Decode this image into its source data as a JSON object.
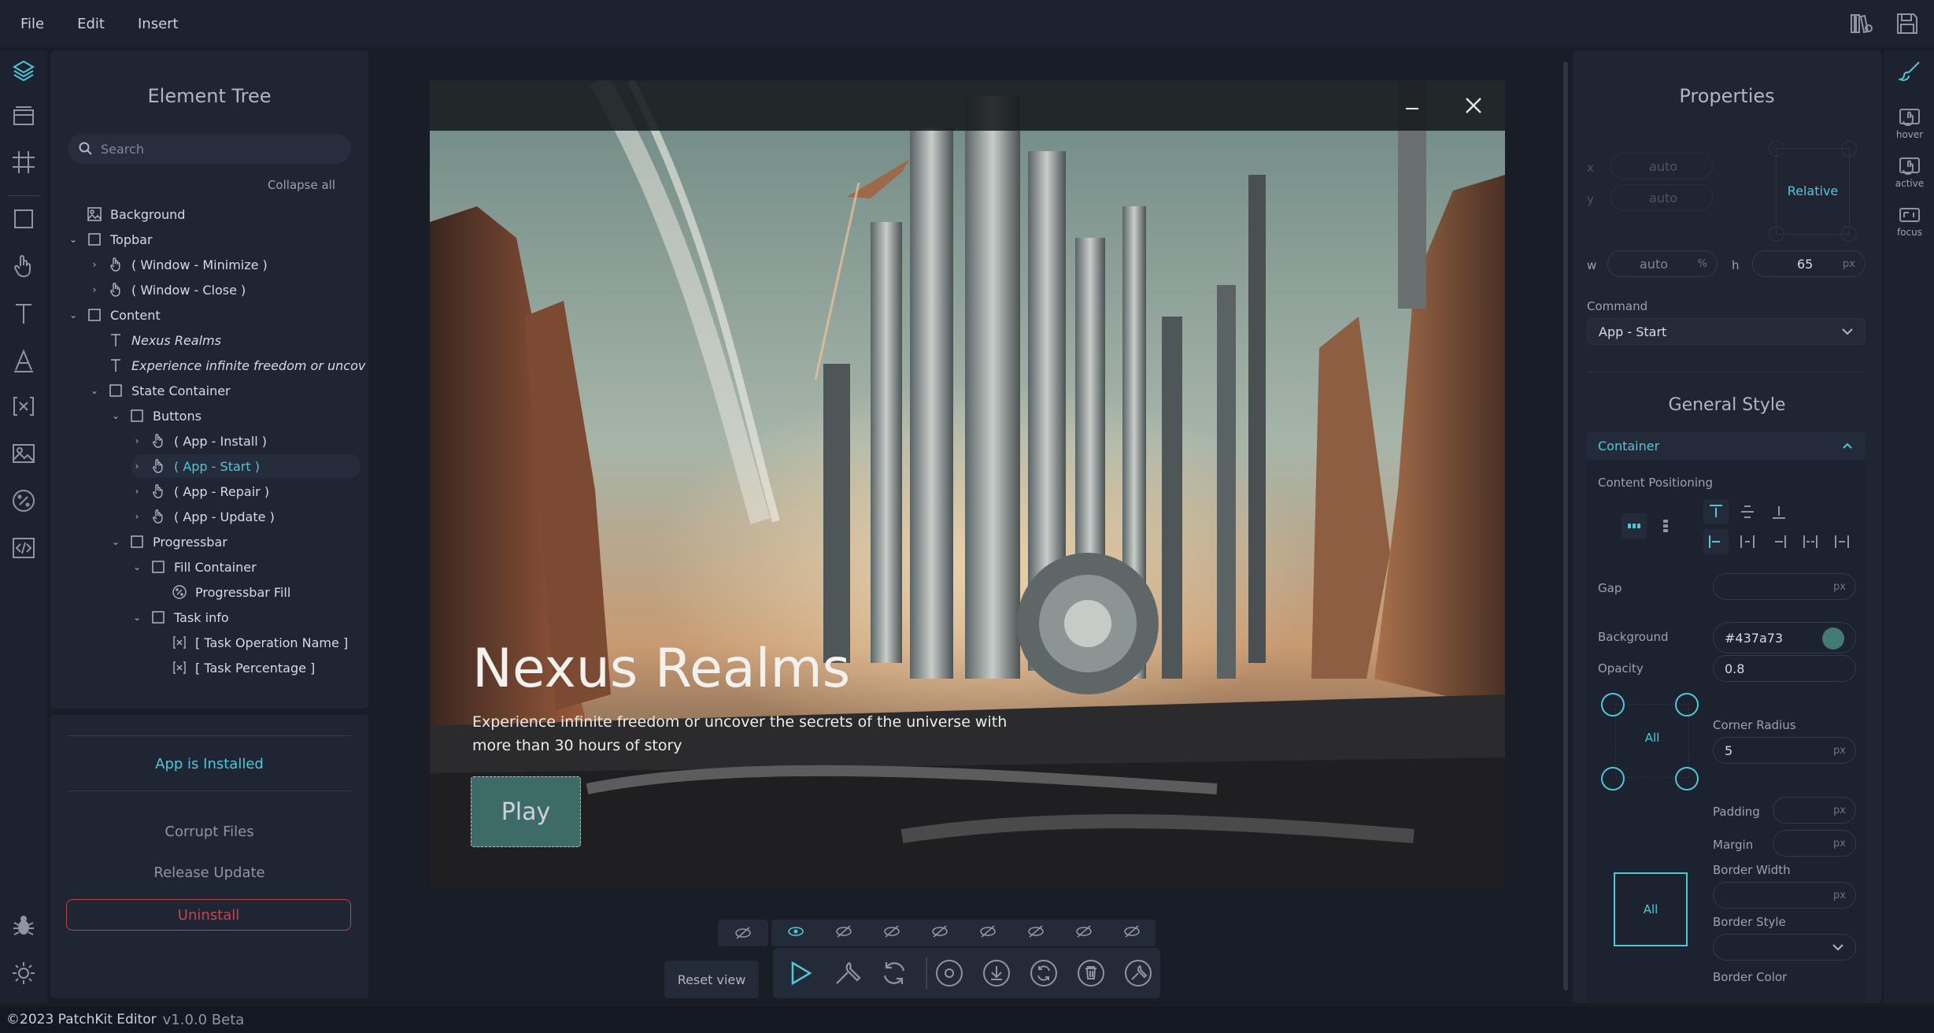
{
  "menu": {
    "file": "File",
    "edit": "Edit",
    "insert": "Insert"
  },
  "element_tree": {
    "title": "Element Tree",
    "search_placeholder": "Search",
    "collapse_all": "Collapse all",
    "nodes": [
      {
        "label": "Background",
        "icon": "image-icon"
      },
      {
        "label": "Topbar",
        "icon": "container-icon"
      },
      {
        "label": "( Window - Minimize )",
        "icon": "hand-icon"
      },
      {
        "label": "( Window - Close )",
        "icon": "hand-icon"
      },
      {
        "label": "Content",
        "icon": "container-icon"
      },
      {
        "label": "Nexus Realms",
        "icon": "text-icon"
      },
      {
        "label": "Experience infinite freedom or uncov",
        "icon": "text-icon"
      },
      {
        "label": "State Container",
        "icon": "container-icon"
      },
      {
        "label": "Buttons",
        "icon": "container-icon"
      },
      {
        "label": "( App - Install )",
        "icon": "hand-icon"
      },
      {
        "label": "( App - Start )",
        "icon": "hand-icon",
        "selected": true
      },
      {
        "label": "( App - Repair )",
        "icon": "hand-icon"
      },
      {
        "label": "( App - Update )",
        "icon": "hand-icon"
      },
      {
        "label": "Progressbar",
        "icon": "container-icon"
      },
      {
        "label": "Fill Container",
        "icon": "container-icon"
      },
      {
        "label": "Progressbar Fill",
        "icon": "percent-icon"
      },
      {
        "label": "Task info",
        "icon": "container-icon"
      },
      {
        "label": "[ Task Operation Name ]",
        "icon": "variable-icon"
      },
      {
        "label": "[ Task Percentage ]",
        "icon": "variable-icon"
      }
    ]
  },
  "states": {
    "installed": "App is Installed",
    "corrupt": "Corrupt Files",
    "release": "Release Update",
    "uninstall": "Uninstall"
  },
  "preview": {
    "title": "Nexus Realms",
    "description": "Experience infinite freedom or uncover the secrets of the universe with more than 30 hours of story",
    "play": "Play"
  },
  "toolbar": {
    "reset_view": "Reset view"
  },
  "footer": {
    "copyright": "©2023 PatchKit Editor",
    "version": "v1.0.0 Beta"
  },
  "properties": {
    "title": "Properties",
    "x_label": "x",
    "x_value": "auto",
    "y_label": "y",
    "y_value": "auto",
    "position_mode": "Relative",
    "w_label": "w",
    "w_value": "auto",
    "w_unit": "%",
    "h_label": "h",
    "h_value": "65",
    "h_unit": "px",
    "command_label": "Command",
    "command_value": "App - Start",
    "general_style": "General Style",
    "container": "Container",
    "content_positioning": "Content Positioning",
    "gap": "Gap",
    "gap_unit": "px",
    "background_label": "Background",
    "background_value": "#437a73",
    "opacity_label": "Opacity",
    "opacity_value": "0.8",
    "corner_radius_label": "Corner Radius",
    "corner_radius_value": "5",
    "corner_unit": "px",
    "all": "All",
    "padding": "Padding",
    "padding_unit": "px",
    "margin": "Margin",
    "margin_unit": "px",
    "border_width": "Border Width",
    "border_width_unit": "px",
    "border_style": "Border Style",
    "border_color": "Border Color"
  },
  "right_states": {
    "hover": "hover",
    "active": "active",
    "focus": "focus"
  },
  "colors": {
    "accent": "#4ec8d8",
    "button_bg": "#437a73",
    "danger": "#c2474d"
  }
}
